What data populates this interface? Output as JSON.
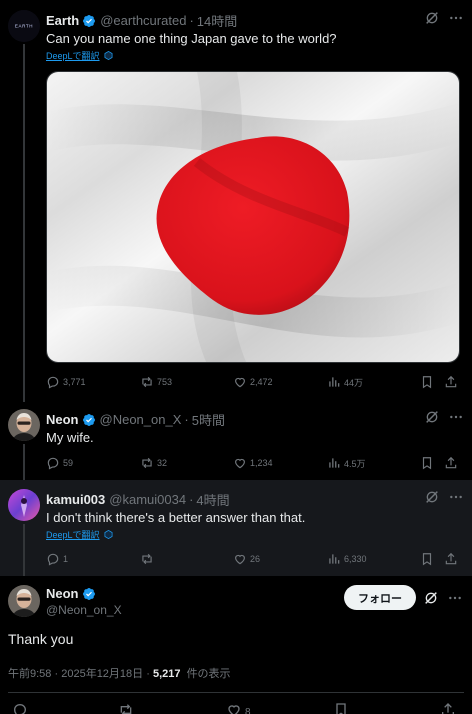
{
  "colors": {
    "accent": "#1d9bf0",
    "text": "#e7e9ea",
    "muted": "#71767b",
    "flag_red": "#e0141c"
  },
  "tweet1": {
    "name": "Earth",
    "handle": "@earthcurated",
    "time": "14時間",
    "text": "Can you name one thing Japan gave to the world?",
    "translate": "DeepLで翻訳",
    "media_alt": "Japanese flag",
    "stats": {
      "replies": "3,771",
      "reposts": "753",
      "likes": "2,472",
      "views": "44万"
    }
  },
  "tweet2": {
    "name": "Neon",
    "handle": "@Neon_on_X",
    "time": "5時間",
    "text": "My wife.",
    "stats": {
      "replies": "59",
      "reposts": "32",
      "likes": "1,234",
      "views": "4.5万"
    }
  },
  "tweet3": {
    "name": "kamui003",
    "handle": "@kamui0034",
    "time": "4時間",
    "text": "I don't think there's a better answer than that.",
    "translate": "DeepLで翻訳",
    "stats": {
      "replies": "1",
      "reposts": "",
      "likes": "26",
      "views": "6,330"
    }
  },
  "main": {
    "name": "Neon",
    "handle": "@Neon_on_X",
    "follow_label": "フォロー",
    "text": "Thank you",
    "time": "午前9:58",
    "date": "2025年12月18日",
    "views_count": "5,217",
    "views_label": "件の表示",
    "likes": "8"
  }
}
